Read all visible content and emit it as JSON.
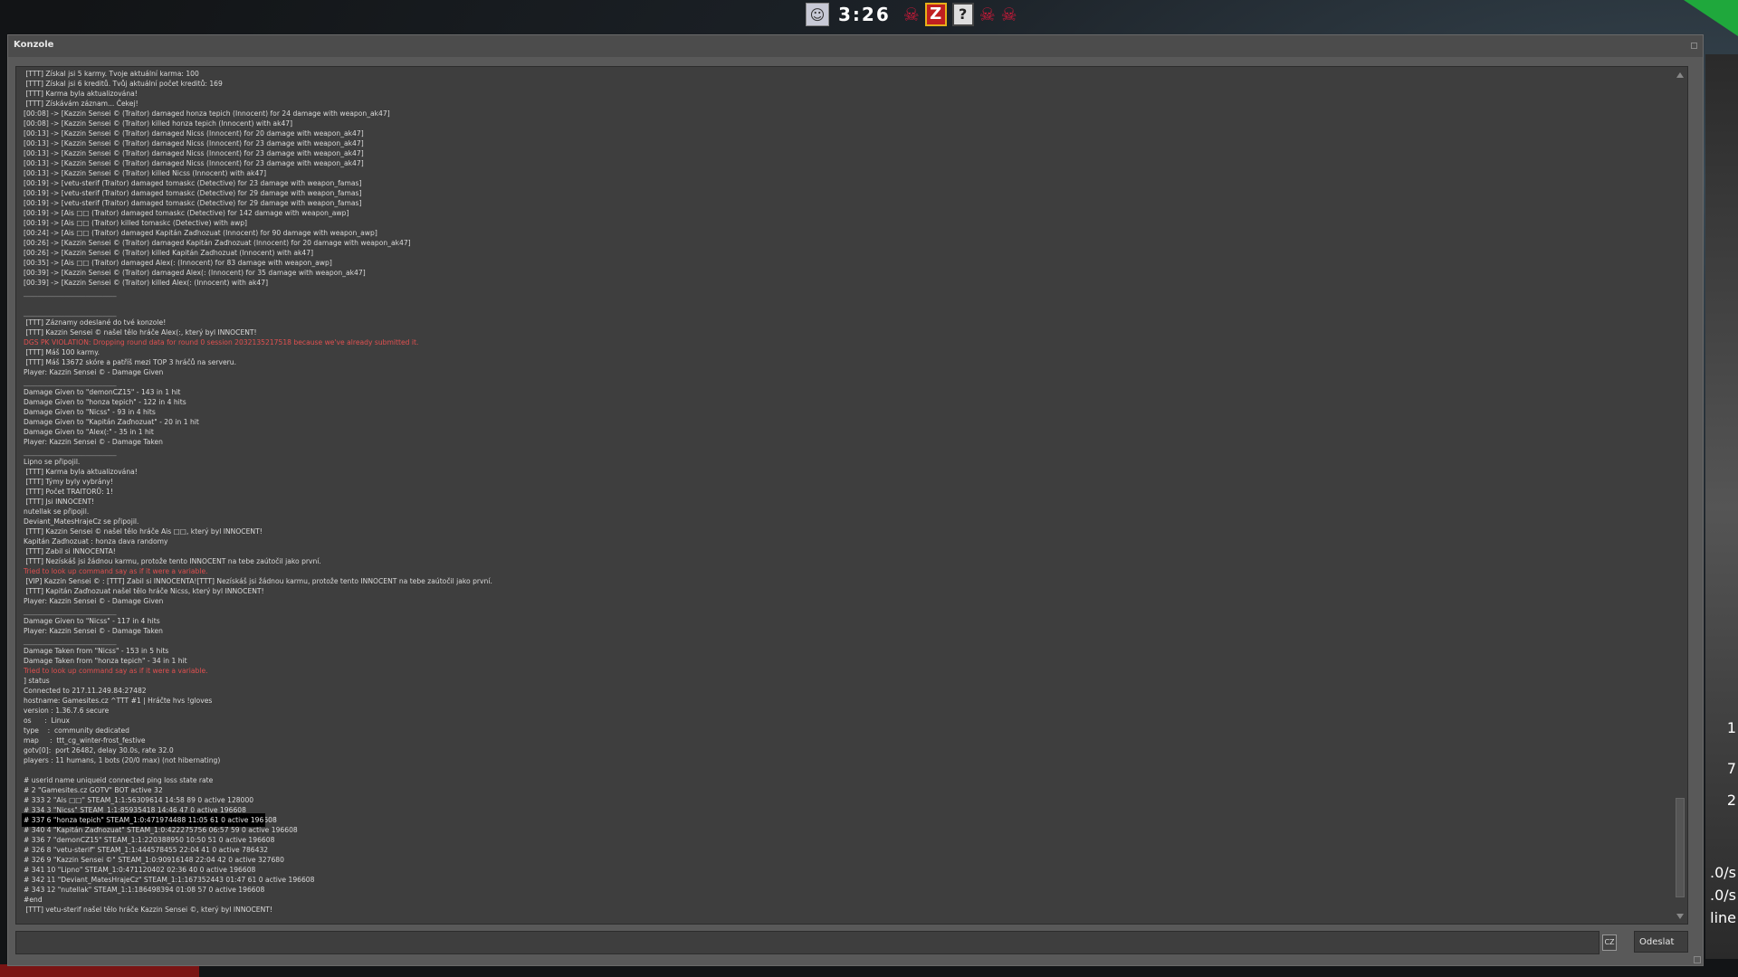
{
  "hud": {
    "timer": "3:26",
    "z_label": "Z",
    "q_label": "?"
  },
  "side_stats": [
    "1",
    "7",
    "2",
    ".0/s",
    ".0/s",
    "line"
  ],
  "console": {
    "title": "Konzole",
    "input_value": "",
    "lang_badge": "CZ",
    "send_label": "Odeslat",
    "highlight_index": 75,
    "lines": [
      {
        "text": " [TTT] Získal jsi 5 karmy. Tvoje aktuální karma: 100"
      },
      {
        "text": " [TTT] Získal jsi 6 kreditů. Tvůj aktuální počet kreditů: 169"
      },
      {
        "text": " [TTT] Karma byla aktualizována!"
      },
      {
        "text": " [TTT] Získávám záznam... Čekej!"
      },
      {
        "text": "[00:08] -> [Kazzin Sensei © (Traitor) damaged honza tepich (Innocent) for 24 damage with weapon_ak47]"
      },
      {
        "text": "[00:08] -> [Kazzin Sensei © (Traitor) killed honza tepich (Innocent) with ak47]"
      },
      {
        "text": "[00:13] -> [Kazzin Sensei © (Traitor) damaged Nicss (Innocent) for 20 damage with weapon_ak47]"
      },
      {
        "text": "[00:13] -> [Kazzin Sensei © (Traitor) damaged Nicss (Innocent) for 23 damage with weapon_ak47]"
      },
      {
        "text": "[00:13] -> [Kazzin Sensei © (Traitor) damaged Nicss (Innocent) for 23 damage with weapon_ak47]"
      },
      {
        "text": "[00:13] -> [Kazzin Sensei © (Traitor) damaged Nicss (Innocent) for 23 damage with weapon_ak47]"
      },
      {
        "text": "[00:13] -> [Kazzin Sensei © (Traitor) killed Nicss (Innocent) with ak47]"
      },
      {
        "text": "[00:19] -> [vetu-sterif (Traitor) damaged tomaskc (Detective) for 23 damage with weapon_famas]"
      },
      {
        "text": "[00:19] -> [vetu-sterif (Traitor) damaged tomaskc (Detective) for 29 damage with weapon_famas]"
      },
      {
        "text": "[00:19] -> [vetu-sterif (Traitor) damaged tomaskc (Detective) for 29 damage with weapon_famas]"
      },
      {
        "text": "[00:19] -> [Ais □□ (Traitor) damaged tomaskc (Detective) for 142 damage with weapon_awp]"
      },
      {
        "text": "[00:19] -> [Ais □□ (Traitor) killed tomaskc (Detective) with awp]"
      },
      {
        "text": "[00:24] -> [Ais □□ (Traitor) damaged Kapitán Zaďnozuat (Innocent) for 90 damage with weapon_awp]"
      },
      {
        "text": "[00:26] -> [Kazzin Sensei © (Traitor) damaged Kapitán Zaďnozuat (Innocent) for 20 damage with weapon_ak47]"
      },
      {
        "text": "[00:26] -> [Kazzin Sensei © (Traitor) killed Kapitán Zaďnozuat (Innocent) with ak47]"
      },
      {
        "text": "[00:35] -> [Ais □□ (Traitor) damaged Alex(: (Innocent) for 83 damage with weapon_awp]"
      },
      {
        "text": "[00:39] -> [Kazzin Sensei © (Traitor) damaged Alex(: (Innocent) for 35 damage with weapon_ak47]"
      },
      {
        "text": "[00:39] -> [Kazzin Sensei © (Traitor) killed Alex(: (Innocent) with ak47]"
      },
      {
        "text": "___________________________",
        "kind": "sep"
      },
      {
        "text": ""
      },
      {
        "text": "___________________________",
        "kind": "sep"
      },
      {
        "text": " [TTT] Záznamy odeslané do tvé konzole!"
      },
      {
        "text": " [TTT] Kazzin Sensei © našel tělo hráče Alex(:, který byl INNOCENT!"
      },
      {
        "text": "DGS PK VIOLATION: Dropping round data for round 0 session 2032135217518 because we've already submitted it.",
        "kind": "warn"
      },
      {
        "text": " [TTT] Máš 100 karmy."
      },
      {
        "text": " [TTT] Máš 13672 skóre a patříš mezi TOP 3 hráčů na serveru."
      },
      {
        "text": "Player: Kazzin Sensei © - Damage Given"
      },
      {
        "text": "___________________________",
        "kind": "sep"
      },
      {
        "text": "Damage Given to \"demonCZ15\" - 143 in 1 hit"
      },
      {
        "text": "Damage Given to \"honza tepich\" - 122 in 4 hits"
      },
      {
        "text": "Damage Given to \"Nicss\" - 93 in 4 hits"
      },
      {
        "text": "Damage Given to \"Kapitán Zaďnozuat\" - 20 in 1 hit"
      },
      {
        "text": "Damage Given to \"Alex(:\" - 35 in 1 hit"
      },
      {
        "text": "Player: Kazzin Sensei © - Damage Taken"
      },
      {
        "text": "___________________________",
        "kind": "sep"
      },
      {
        "text": "Lipno se připojil."
      },
      {
        "text": " [TTT] Karma byla aktualizována!"
      },
      {
        "text": " [TTT] Týmy byly vybrány!"
      },
      {
        "text": " [TTT] Počet TRAITORŮ: 1!"
      },
      {
        "text": " [TTT] Jsi INNOCENT!"
      },
      {
        "text": "nutellak se připojil."
      },
      {
        "text": "Deviant_MatesHrajeCz se připojil."
      },
      {
        "text": " [TTT] Kazzin Sensei © našel tělo hráče Ais □□, který byl INNOCENT!"
      },
      {
        "text": "Kapitán Zaďnozuat : honza dava randomy"
      },
      {
        "text": " [TTT] Zabil si INNOCENTA!"
      },
      {
        "text": " [TTT] Nezískáš jsi žádnou karmu, protože tento INNOCENT na tebe zaútočil jako první."
      },
      {
        "text": "Tried to look up command say as if it were a variable.",
        "kind": "warn"
      },
      {
        "text": " [VIP] Kazzin Sensei © : [TTT] Zabil si INNOCENTA![TTT] Nezískáš jsi žádnou karmu, protože tento INNOCENT na tebe zaútočil jako první."
      },
      {
        "text": " [TTT] Kapitán Zaďnozuat našel tělo hráče Nicss, který byl INNOCENT!"
      },
      {
        "text": "Player: Kazzin Sensei © - Damage Given"
      },
      {
        "text": "___________________________",
        "kind": "sep"
      },
      {
        "text": "Damage Given to \"Nicss\" - 117 in 4 hits"
      },
      {
        "text": "Player: Kazzin Sensei © - Damage Taken"
      },
      {
        "text": "___________________________",
        "kind": "sep"
      },
      {
        "text": "Damage Taken from \"Nicss\" - 153 in 5 hits"
      },
      {
        "text": "Damage Taken from \"honza tepich\" - 34 in 1 hit"
      },
      {
        "text": "Tried to look up command say as if it were a variable.",
        "kind": "warn"
      },
      {
        "text": "] status"
      },
      {
        "text": "Connected to 217.11.249.84:27482"
      },
      {
        "text": "hostname: Gamesites.cz ^TTT #1 | Hráčte hvs !gloves"
      },
      {
        "text": "version : 1.36.7.6 secure"
      },
      {
        "text": "os      :  Linux"
      },
      {
        "text": "type    :  community dedicated"
      },
      {
        "text": "map     :  ttt_cg_winter-frost_festive"
      },
      {
        "text": "gotv[0]:  port 26482, delay 30.0s, rate 32.0"
      },
      {
        "text": "players : 11 humans, 1 bots (20/0 max) (not hibernating)"
      },
      {
        "text": ""
      },
      {
        "text": "# userid name uniqueid connected ping loss state rate"
      },
      {
        "text": "# 2 \"Gamesites.cz GOTV\" BOT active 32"
      },
      {
        "text": "# 333 2 \"Ais □□\" STEAM_1:1:56309614 14:58 89 0 active 128000"
      },
      {
        "text": "# 334 3 \"Nicss\" STEAM_1:1:85935418 14:46 47 0 active 196608"
      },
      {
        "text": "# 337 6 \"honza tepich\" STEAM_1:0:471974488 11:05 61 0 active 196608"
      },
      {
        "text": "# 340 4 \"Kapitán Zaďnozuat\" STEAM_1:0:422275756 06:57 59 0 active 196608"
      },
      {
        "text": "# 336 7 \"demonCZ15\" STEAM_1:1:220388950 10:50 51 0 active 196608"
      },
      {
        "text": "# 326 8 \"vetu-sterif\" STEAM_1:1:444578455 22:04 41 0 active 786432"
      },
      {
        "text": "# 326 9 \"Kazzin Sensei ©\" STEAM_1:0:90916148 22:04 42 0 active 327680"
      },
      {
        "text": "# 341 10 \"Lipno\" STEAM_1:0:471120402 02:36 40 0 active 196608"
      },
      {
        "text": "# 342 11 \"Deviant_MatesHrajeCz\" STEAM_1:1:167352443 01:47 61 0 active 196608"
      },
      {
        "text": "# 343 12 \"nutellak\" STEAM_1:1:186498394 01:08 57 0 active 196608"
      },
      {
        "text": "#end"
      },
      {
        "text": " [TTT] vetu-sterif našel tělo hráče Kazzin Sensei ©, který byl INNOCENT!"
      }
    ]
  }
}
